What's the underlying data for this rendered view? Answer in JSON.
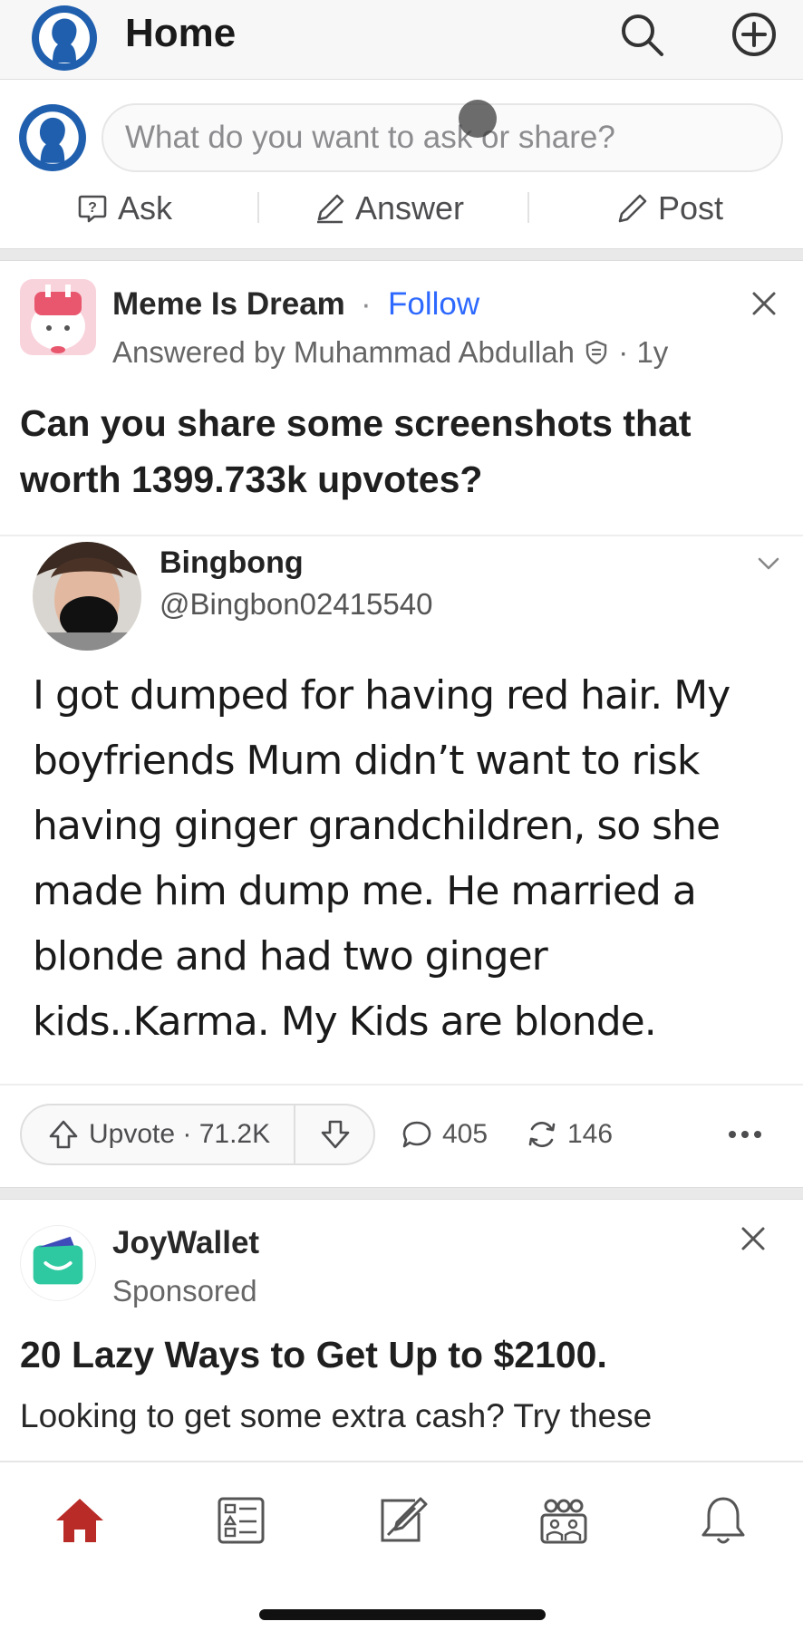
{
  "header": {
    "title": "Home",
    "icons": [
      "avatar",
      "search-icon",
      "add-icon"
    ]
  },
  "composer": {
    "placeholder": "What do you want to ask or share?",
    "actions": [
      {
        "label": "Ask",
        "icon": "ask-icon"
      },
      {
        "label": "Answer",
        "icon": "answer-icon"
      },
      {
        "label": "Post",
        "icon": "post-icon"
      }
    ]
  },
  "post": {
    "space_name": "Meme Is Dream",
    "separator": "·",
    "follow_label": "Follow",
    "answered_by": "Answered by Muhammad Abdullah",
    "age": "· 1y",
    "question": "Can you share some screenshots that worth 1399.733k upvotes?",
    "screenshot": {
      "name": "Bingbong",
      "handle": "@Bingbon02415540",
      "text": "I got dumped for having red hair. My boyfriends Mum  didn’t want to risk having ginger grandchildren, so she made him dump me. He married a blonde and had two ginger kids..Karma. My Kids are blonde."
    },
    "upvote_label": "Upvote · 71.2K",
    "comments": "405",
    "shares": "146"
  },
  "ad": {
    "advertiser": "JoyWallet",
    "sponsored_label": "Sponsored",
    "headline": "20 Lazy Ways to Get Up to $2100.",
    "body": "Looking to get some extra cash? Try these"
  },
  "tabbar": {
    "items": [
      "home-icon",
      "following-icon",
      "answer-icon",
      "spaces-icon",
      "notifications-icon"
    ],
    "active": "home-icon"
  },
  "colors": {
    "brand_red": "#b92b27",
    "link_blue": "#2e69ff",
    "ad_green": "#2fc9a1"
  }
}
